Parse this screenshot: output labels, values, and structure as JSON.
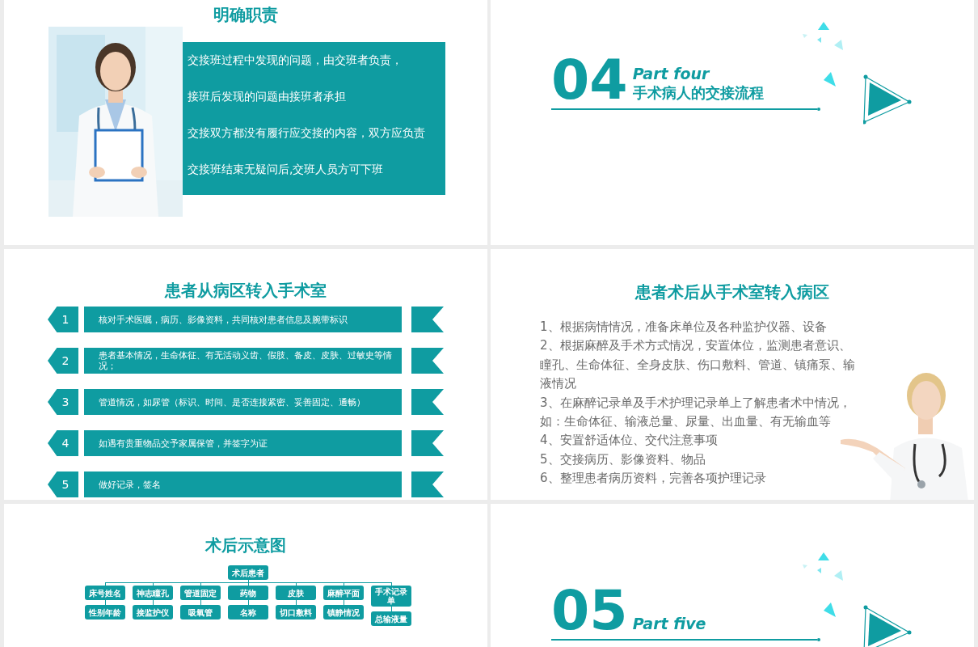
{
  "slides": [
    {
      "kind": "duties",
      "title": "明确职责",
      "points": [
        "交接班过程中发现的问题，由交班者负责，",
        "接班后发现的问题由接班者承担",
        "交接双方都没有履行应交接的内容，双方应负责",
        "交接班结束无疑问后,交班人员方可下班"
      ]
    },
    {
      "kind": "section",
      "number": "04",
      "part": "Part four",
      "subtitle": "手术病人的交接流程"
    },
    {
      "kind": "steps",
      "title": "患者从病区转入手术室",
      "steps": [
        {
          "number": "1",
          "text": "核对手术医嘱，病历、影像资料，共同核对患者信息及腕带标识"
        },
        {
          "number": "2",
          "text": "患者基本情况，生命体征、有无活动义齿、假肢、备皮、皮肤、过敏史等情况；"
        },
        {
          "number": "3",
          "text": "管道情况，如尿管（标识、时间、是否连接紧密、妥善固定、通畅）"
        },
        {
          "number": "4",
          "text": "如遇有贵重物品交予家属保管，并签字为证"
        },
        {
          "number": "5",
          "text": "做好记录，签名"
        }
      ]
    },
    {
      "kind": "list",
      "title": "患者术后从手术室转入病区",
      "items": [
        "1、根据病情情况，准备床单位及各种监护仪器、设备",
        "2、根据麻醉及手术方式情况，安置体位，监测患者意识、瞳孔、生命体征、全身皮肤、伤口敷料、管道、镇痛泵、输液情况",
        "3、在麻醉记录单及手术护理记录单上了解患者术中情况，如：生命体征、输液总量、尿量、出血量、有无输血等",
        "4、安置舒适体位、交代注意事项",
        "5、交接病历、影像资料、物品",
        "6、整理患者病历资料，完善各项护理记录"
      ]
    },
    {
      "kind": "chart",
      "title": "术后示意图",
      "root": "术后患者",
      "branches": [
        {
          "label": "床号姓名",
          "children": [
            "性别年龄"
          ]
        },
        {
          "label": "神志瞳孔",
          "children": [
            "接监护仪"
          ]
        },
        {
          "label": "管道固定",
          "children": [
            "吸氧管"
          ]
        },
        {
          "label": "药物",
          "children": [
            "名称"
          ]
        },
        {
          "label": "皮肤",
          "children": [
            "切口敷料"
          ]
        },
        {
          "label": "麻醉平面",
          "children": [
            "镇静情况"
          ]
        },
        {
          "label": "手术记录单",
          "children": [
            "总输液量"
          ]
        }
      ]
    },
    {
      "kind": "section",
      "number": "05",
      "part": "Part five"
    }
  ]
}
